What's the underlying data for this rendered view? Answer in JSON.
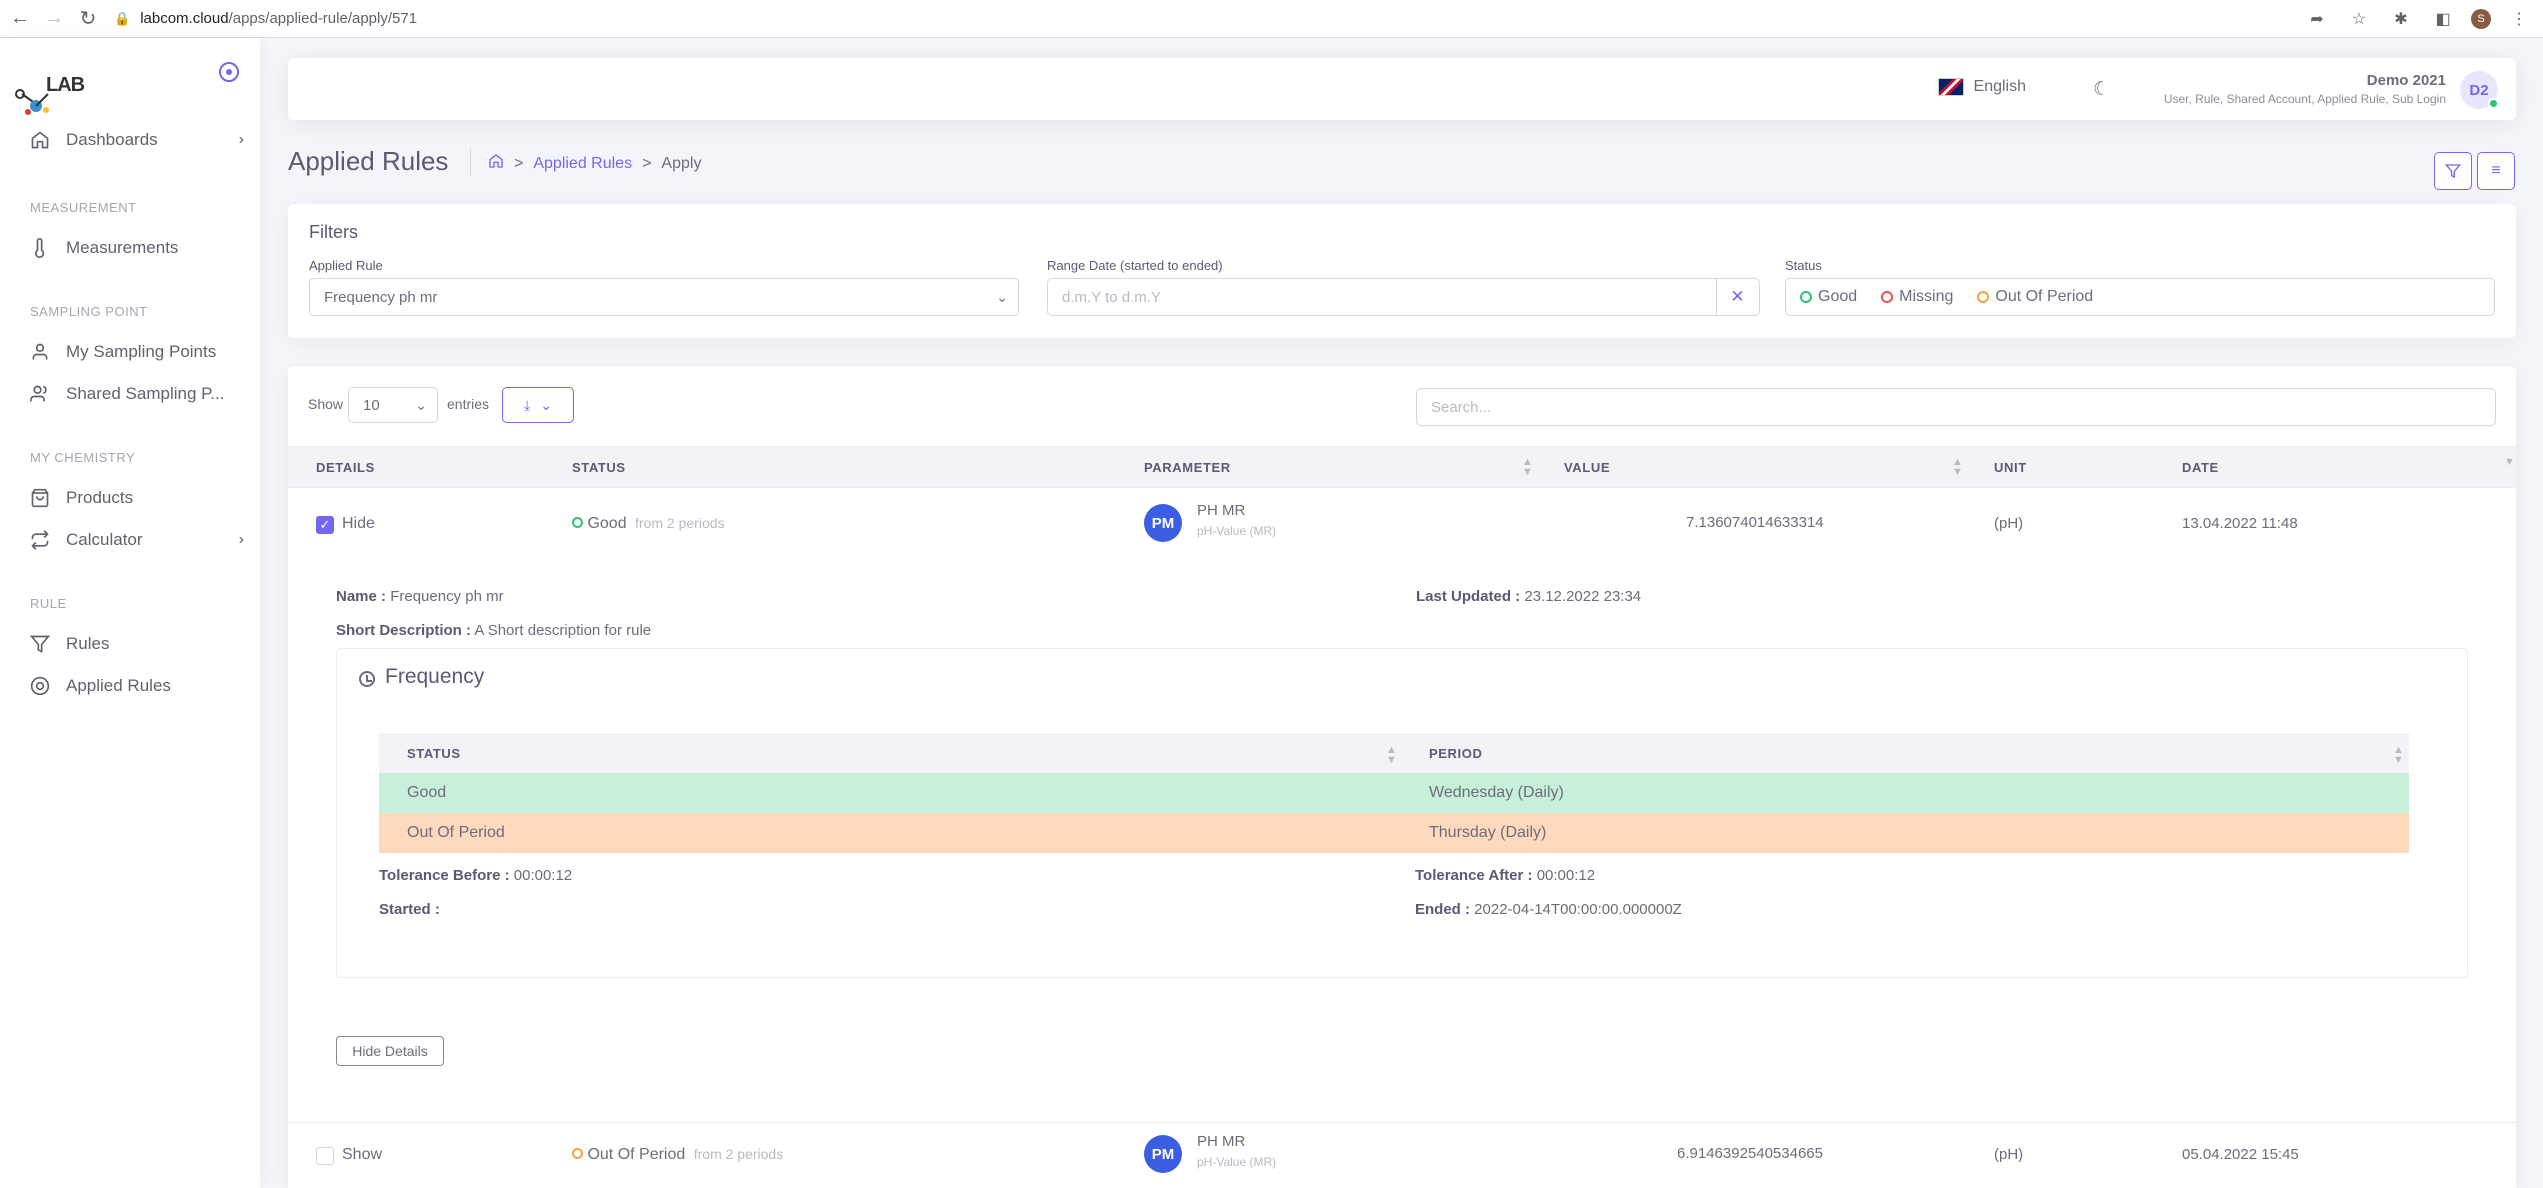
{
  "browser": {
    "url_host": "labcom.cloud",
    "url_path": "/apps/applied-rule/apply/571"
  },
  "sidebar": {
    "logo_text": "LAB",
    "items": {
      "dashboards": "Dashboards",
      "measurement_header": "MEASUREMENT",
      "measurements": "Measurements",
      "sampling_header": "SAMPLING POINT",
      "my_sampling_points": "My Sampling Points",
      "shared_sampling_points": "Shared Sampling P...",
      "chemistry_header": "MY CHEMISTRY",
      "products": "Products",
      "calculator": "Calculator",
      "rule_header": "RULE",
      "rules": "Rules",
      "applied_rules": "Applied Rules"
    }
  },
  "navbar": {
    "language": "English",
    "user_name": "Demo 2021",
    "user_roles": "User, Rule, Shared Account, Applied Rule, Sub Login",
    "avatar_initials": "D2"
  },
  "page": {
    "title": "Applied Rules",
    "breadcrumb_link": "Applied Rules",
    "breadcrumb_sep": ">",
    "breadcrumb_current": "Apply"
  },
  "filters": {
    "title": "Filters",
    "applied_rule_label": "Applied Rule",
    "applied_rule_value": "Frequency ph mr",
    "range_label": "Range Date (started to ended)",
    "range_placeholder": "d.m.Y to d.m.Y",
    "status_label": "Status",
    "status_options": [
      "Good",
      "Missing",
      "Out Of Period"
    ],
    "status_colors": [
      "#28c76f",
      "#ea5455",
      "#ff9f43"
    ]
  },
  "table": {
    "show_label": "Show",
    "entries_value": "10",
    "entries_label": "entries",
    "search_placeholder": "Search...",
    "headers": [
      "DETAILS",
      "STATUS",
      "PARAMETER",
      "VALUE",
      "UNIT",
      "DATE"
    ],
    "rows": [
      {
        "toggle": "Hide",
        "status": "Good",
        "status_from": "from 2 periods",
        "avatar": "PM",
        "param_name": "PH MR",
        "param_sub": "pH-Value (MR)",
        "value": "7.136074014633314",
        "unit": "(pH)",
        "date": "13.04.2022 11:48"
      },
      {
        "toggle": "Show",
        "status": "Out Of Period",
        "status_from": "from 2 periods",
        "avatar": "PM",
        "param_name": "PH MR",
        "param_sub": "pH-Value (MR)",
        "value": "6.9146392540534665",
        "unit": "(pH)",
        "date": "05.04.2022 15:45"
      }
    ]
  },
  "details": {
    "name_label": "Name :",
    "name_value": "Frequency ph mr",
    "short_desc_label": "Short Description :",
    "short_desc_value": "A Short description for rule",
    "last_updated_label": "Last Updated :",
    "last_updated_value": "23.12.2022 23:34",
    "frequency_title": "Frequency",
    "freq_headers": [
      "STATUS",
      "PERIOD"
    ],
    "freq_rows": [
      {
        "status": "Good",
        "period": "Wednesday (Daily)"
      },
      {
        "status": "Out Of Period",
        "period": "Thursday (Daily)"
      }
    ],
    "tol_before_label": "Tolerance Before :",
    "tol_before_value": "00:00:12",
    "tol_after_label": "Tolerance After :",
    "tol_after_value": "00:00:12",
    "started_label": "Started :",
    "started_value": "",
    "ended_label": "Ended :",
    "ended_value": "2022-04-14T00:00:00.000000Z",
    "hide_button": "Hide Details"
  }
}
